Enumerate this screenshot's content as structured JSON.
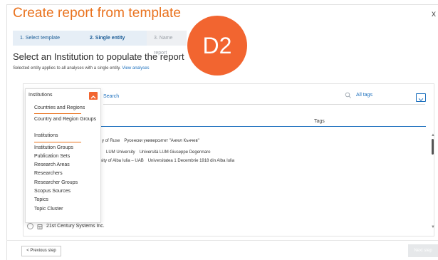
{
  "dialog": {
    "title": "Create report from template",
    "close_label": "x"
  },
  "steps": [
    {
      "label": "1. Select template",
      "state": "done"
    },
    {
      "label": "2. Single entity",
      "state": "active"
    },
    {
      "label": "3. Name report",
      "state": "pending"
    }
  ],
  "badge": {
    "label": "D2",
    "color": "#f26530"
  },
  "main": {
    "heading": "Select an Institution to populate the report",
    "subtext": "Selected entity applies to all analyses with a single entity.",
    "subtext_link": "View analyses"
  },
  "search": {
    "placeholder": "Search",
    "filter_label": "All tags"
  },
  "table": {
    "tags_header": "Tags",
    "rows": [
      {
        "name_fragment": "y of Ruse",
        "local_name": "Русенски университет \"Ангел Кънчев\""
      },
      {
        "name_fragment": "LUM University",
        "local_name": "Università LUM Giuseppe Degennaro"
      },
      {
        "name_fragment": "sity of Alba Iulia – UAB",
        "local_name": "Universitatea 1 Decembrie 1918 din Alba Iulia"
      }
    ],
    "last_row": "21st Century Systems Inc."
  },
  "dropdown": {
    "selected": "Institutions",
    "options": [
      "Countries and Regions",
      "Country and Region Groups",
      "Institutions",
      "Institution Groups",
      "Publication Sets",
      "Research Areas",
      "Researchers",
      "Researcher Groups",
      "Scopus Sources",
      "Topics",
      "Topic Cluster"
    ]
  },
  "footer": {
    "prev_label": "< Previous step",
    "next_label": "Next step"
  },
  "colors": {
    "accent": "#e9711c",
    "link": "#1b6fbd",
    "badge": "#f26530"
  }
}
